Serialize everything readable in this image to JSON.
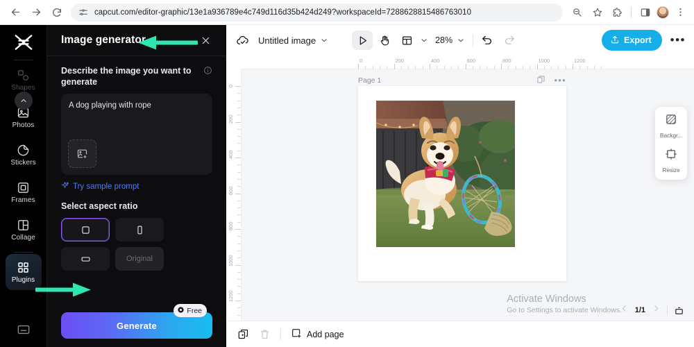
{
  "browser": {
    "url": "capcut.com/editor-graphic/13e1a936789e4c749d116d35b424d249?workspaceId=7288628815486763010",
    "back_icon": "back-arrow-icon",
    "forward_icon": "forward-arrow-icon",
    "reload_icon": "reload-icon",
    "site_info_icon": "site-settings-icon",
    "zoom_icon": "zoom-magnifier-icon",
    "bookmark_icon": "star-icon",
    "extensions_icon": "puzzle-icon",
    "sidepanel_icon": "side-panel-icon",
    "profile_icon": "avatar-icon",
    "menu_icon": "three-dot-menu-icon"
  },
  "rail": {
    "logo": "capcut-logo",
    "scroll_up_icon": "chevron-up-icon",
    "items": [
      {
        "label": "Shapes",
        "icon": "shapes-icon",
        "state": "dim"
      },
      {
        "label": "Photos",
        "icon": "photo-icon",
        "state": "normal"
      },
      {
        "label": "Stickers",
        "icon": "sticker-icon",
        "state": "normal"
      },
      {
        "label": "Frames",
        "icon": "frame-icon",
        "state": "normal"
      },
      {
        "label": "Collage",
        "icon": "collage-icon",
        "state": "normal"
      },
      {
        "label": "Plugins",
        "icon": "plugins-grid-icon",
        "state": "active"
      }
    ],
    "bottom_icon": "keyboard-shortcuts-icon"
  },
  "panel": {
    "title": "Image generator",
    "close_icon": "close-x-icon",
    "prompt_section_label": "Describe the image you want to generate",
    "info_icon": "info-circle-icon",
    "prompt_value": "A dog playing with rope",
    "prompt_placeholder": "Describe the image you want to generate",
    "add_image_icon": "add-image-icon",
    "sample_prompt_label": "Try sample prompt",
    "sample_prompt_icon": "sparkle-icon",
    "aspect_label": "Select aspect ratio",
    "aspect_options": [
      {
        "name": "square",
        "icon": "square-ratio-icon",
        "selected": true
      },
      {
        "name": "portrait",
        "icon": "portrait-ratio-icon",
        "selected": false
      },
      {
        "name": "landscape",
        "icon": "landscape-ratio-icon",
        "selected": false
      }
    ],
    "aspect_original_label": "Original",
    "generate_label": "Generate",
    "free_badge_label": "Free",
    "free_badge_icon": "credit-coin-icon",
    "collapse_icon": "chevron-left-icon"
  },
  "toolbar": {
    "cloud_icon": "cloud-saved-icon",
    "doc_title": "Untitled image",
    "title_chevron_icon": "chevron-down-icon",
    "select_tool_icon": "cursor-select-icon",
    "hand_tool_icon": "hand-pan-icon",
    "layout_tool_icon": "layout-grid-icon",
    "layout_chevron_icon": "chevron-down-icon",
    "zoom_value": "28%",
    "zoom_chevron_icon": "chevron-down-icon",
    "undo_icon": "undo-arrow-icon",
    "redo_icon": "redo-arrow-icon",
    "export_label": "Export",
    "export_icon": "upload-share-icon",
    "more_icon": "three-dot-menu-icon",
    "accent_export": "#16aee8"
  },
  "canvas": {
    "ruler_h_ticks": [
      "0",
      "200",
      "400",
      "600",
      "800",
      "1000",
      "1200"
    ],
    "ruler_v_ticks": [
      "0",
      "200",
      "400",
      "600",
      "800",
      "1000",
      "1200"
    ],
    "page_label": "Page 1",
    "page_duplicate_icon": "duplicate-page-icon",
    "page_more_icon": "three-dot-menu-icon",
    "image_alt": "generated-dog-with-rope-hoop"
  },
  "float_panel": {
    "items": [
      {
        "label": "Backgr...",
        "icon": "background-checker-icon"
      },
      {
        "label": "Resize",
        "icon": "resize-icon"
      }
    ]
  },
  "watermark": {
    "line1": "Activate Windows",
    "line2": "Go to Settings to activate Windows."
  },
  "pager": {
    "prev_icon": "chevron-left-icon",
    "value": "1/1",
    "next_icon": "chevron-right-icon",
    "present_icon": "present-icon"
  },
  "bottombar": {
    "duplicate_icon": "duplicate-page-icon",
    "delete_icon": "trash-icon",
    "add_page_label": "Add page",
    "add_page_icon": "add-page-icon"
  },
  "annotations": {
    "arrow_color": "#2ee6b0",
    "arrow_title_target": "Image generator",
    "arrow_plugins_target": "Plugins"
  }
}
